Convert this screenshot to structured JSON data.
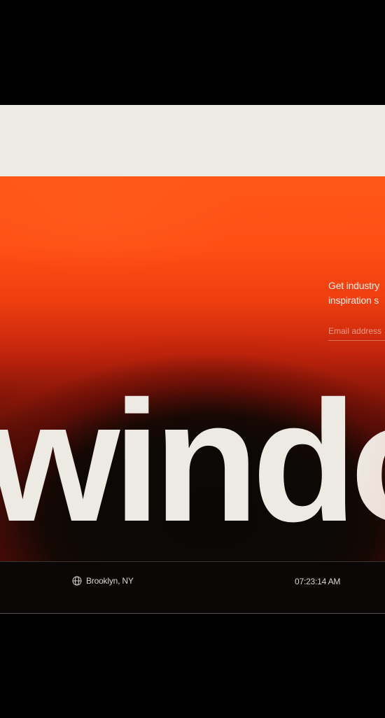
{
  "hero": {
    "wordmark": "window",
    "signup": {
      "line1": "Get industry",
      "line2": "inspiration s",
      "email_placeholder": "Email address"
    }
  },
  "footer": {
    "location": "Brooklyn, NY",
    "location_icon": "globe-icon",
    "time": "07:23:14 AM"
  },
  "colors": {
    "accent": "#ff5718",
    "cream": "#ede9e3",
    "background": "#000000"
  }
}
